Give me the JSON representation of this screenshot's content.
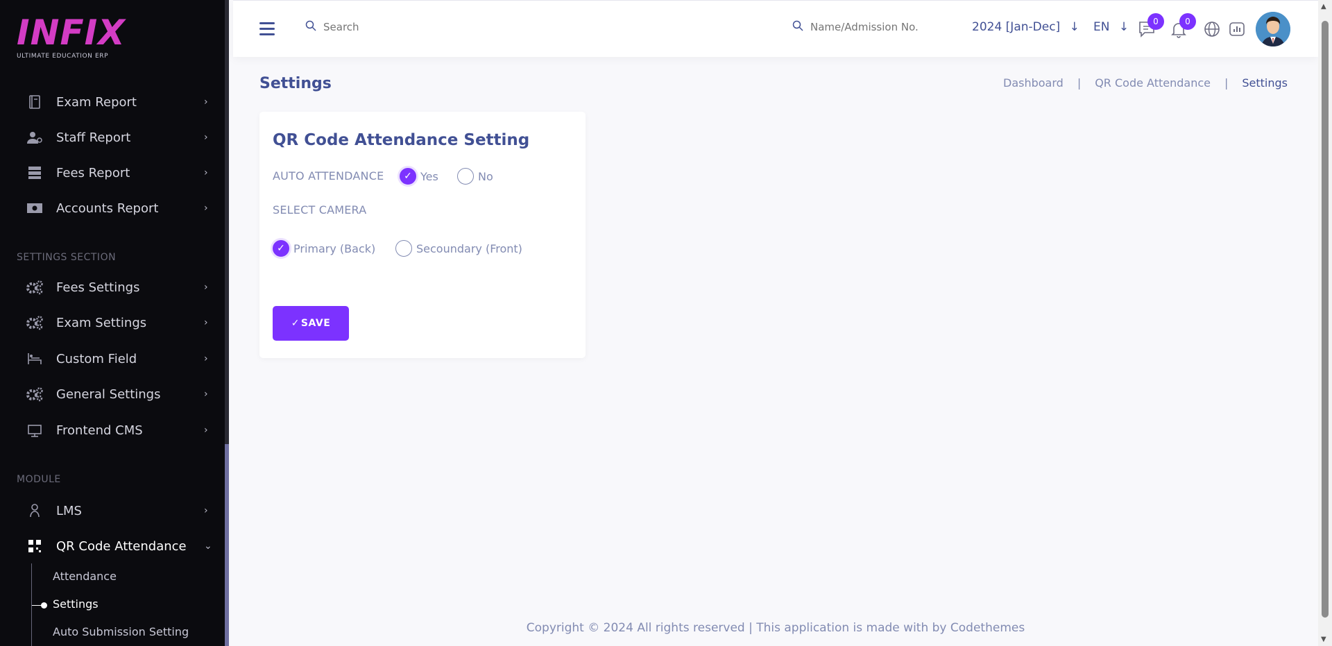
{
  "logo": {
    "main": "INFIX",
    "sub": "ULTIMATE EDUCATION ERP"
  },
  "sidebar": {
    "report_items": [
      {
        "label": "Exam Report",
        "icon": "book-icon"
      },
      {
        "label": "Staff Report",
        "icon": "user-report-icon"
      },
      {
        "label": "Fees Report",
        "icon": "server-icon"
      },
      {
        "label": "Accounts Report",
        "icon": "money-icon"
      }
    ],
    "settings_section_label": "SETTINGS SECTION",
    "settings_items": [
      {
        "label": "Fees Settings",
        "icon": "gears-icon"
      },
      {
        "label": "Exam Settings",
        "icon": "gears-icon"
      },
      {
        "label": "Custom Field",
        "icon": "bed-icon"
      },
      {
        "label": "General Settings",
        "icon": "gears-icon"
      },
      {
        "label": "Frontend CMS",
        "icon": "monitor-icon"
      }
    ],
    "module_label": "MODULE",
    "module_items": [
      {
        "label": "LMS",
        "icon": "lms-icon"
      },
      {
        "label": "QR Code Attendance",
        "icon": "qr-code-icon"
      }
    ],
    "sub_items": [
      "Attendance",
      "Settings",
      "Auto Submission Setting"
    ]
  },
  "topbar": {
    "search_placeholder": "Search",
    "student_search_placeholder": "Name/Admission No.",
    "year": "2024 [Jan-Dec]",
    "language": "EN",
    "messages_count": "0",
    "notifications_count": "0"
  },
  "page": {
    "title": "Settings",
    "breadcrumb": [
      "Dashboard",
      "QR Code Attendance",
      "Settings"
    ]
  },
  "card": {
    "title": "QR Code Attendance Setting",
    "auto_attendance_label": "AUTO ATTENDANCE",
    "yes_label": "Yes",
    "no_label": "No",
    "auto_attendance_value": "Yes",
    "select_camera_label": "SELECT CAMERA",
    "camera_primary_label": "Primary (Back)",
    "camera_secondary_label": "Secoundary (Front)",
    "camera_value": "Primary (Back)",
    "save_label": "SAVE"
  },
  "footer": {
    "text": "Copyright © 2024 All rights reserved | This application is made with by Codethemes"
  },
  "colors": {
    "accent": "#7c32ff",
    "primary_text": "#415094",
    "muted_text": "#828bb2",
    "sidebar_bg": "#0b0b0f"
  }
}
